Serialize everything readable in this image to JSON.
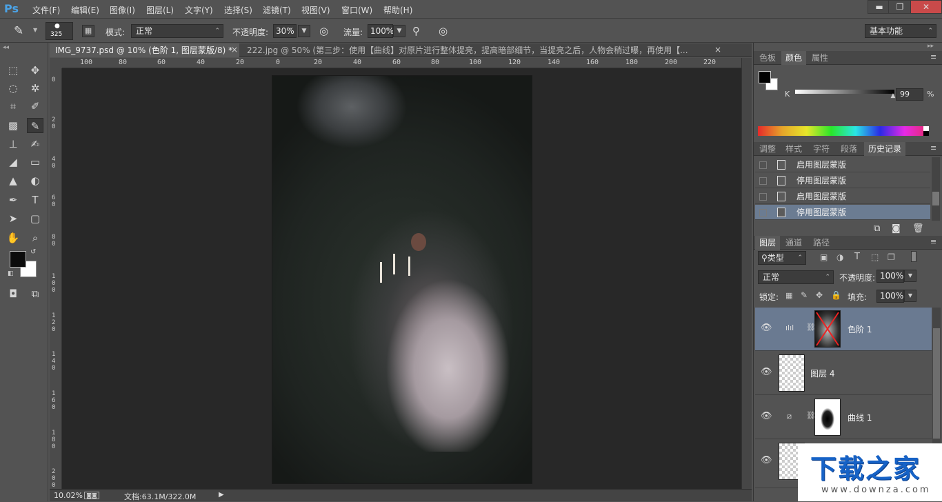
{
  "app": {
    "logo": "Ps"
  },
  "menu": [
    "文件(F)",
    "编辑(E)",
    "图像(I)",
    "图层(L)",
    "文字(Y)",
    "选择(S)",
    "滤镜(T)",
    "视图(V)",
    "窗口(W)",
    "帮助(H)"
  ],
  "window_controls": {
    "minimize": "▬",
    "restore": "❐",
    "close": "✕"
  },
  "options": {
    "brush_size": "325",
    "mode_label": "模式:",
    "mode_value": "正常",
    "opacity_label": "不透明度:",
    "opacity_value": "30%",
    "flow_label": "流量:",
    "flow_value": "100%",
    "workspace": "基本功能"
  },
  "tabs": {
    "doc1": "IMG_9737.psd @ 10% (色阶 1, 图层蒙版/8) *",
    "doc2": "222.jpg @ 50% (第三步：使用【曲线】对原片进行整体提亮，提高暗部细节，当提亮之后，人物会稍过曝，再使用【...",
    "close": "×"
  },
  "ruler_h": [
    "100",
    "80",
    "60",
    "40",
    "20",
    "0",
    "20",
    "40",
    "60",
    "80",
    "100",
    "120",
    "140",
    "160",
    "180",
    "200",
    "220"
  ],
  "ruler_v": [
    "0",
    "2 0",
    "4 0",
    "6 0",
    "8 0",
    "1 0 0",
    "1 2 0",
    "1 4 0",
    "1 6 0",
    "1 8 0",
    "2 0 0"
  ],
  "status": {
    "zoom": "10.02%",
    "doc_size": "文档:63.1M/322.0M"
  },
  "color_panel": {
    "tabs": [
      "色板",
      "颜色",
      "属性"
    ],
    "active_tab": "颜色",
    "channel": "K",
    "value": "99",
    "unit": "%",
    "slider_level": 0.99
  },
  "history_panel": {
    "tabs": [
      "调整",
      "样式",
      "字符",
      "段落",
      "历史记录"
    ],
    "active_tab": "历史记录",
    "items": [
      "启用图层蒙版",
      "停用图层蒙版",
      "启用图层蒙版",
      "停用图层蒙版"
    ]
  },
  "layers_panel": {
    "tabs": [
      "图层",
      "通道",
      "路径"
    ],
    "active_tab": "图层",
    "filter": "类型",
    "blend_mode": "正常",
    "opacity_label": "不透明度:",
    "opacity_value": "100%",
    "lock_label": "锁定:",
    "fill_label": "填充:",
    "fill_value": "100%",
    "layers": [
      "色阶 1",
      "图层 4",
      "曲线 1"
    ]
  },
  "watermark": {
    "title": "下载之家",
    "url": "www.downza.com"
  },
  "colors": {
    "selected_layer": "#6a7a91",
    "selected_history": "#6b7c92",
    "accent": "#4ba3e6"
  }
}
